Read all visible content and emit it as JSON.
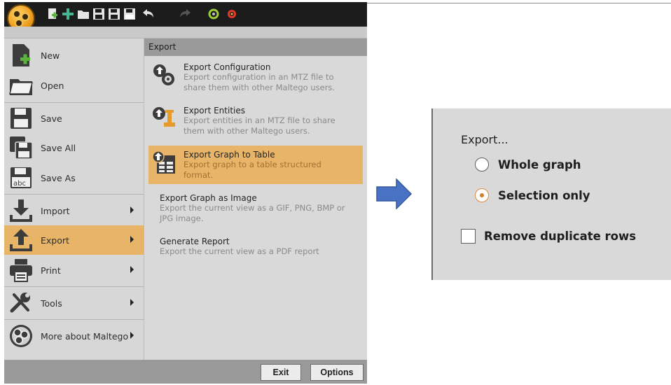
{
  "colors": {
    "accent": "#e8b468",
    "arrow": "#4a72c4",
    "radio_selected": "#d07f2a"
  },
  "toolbar_icons": [
    "new-graph-icon",
    "add-entity-icon",
    "open-folder-icon",
    "save-icon",
    "save-all-icon",
    "save-as-icon",
    "undo-icon",
    "redo-icon",
    "transform-icon",
    "settings-icon"
  ],
  "menu": {
    "items": [
      {
        "label": "New",
        "icon": "new-file-icon",
        "has_submenu": false,
        "active": false
      },
      {
        "label": "Open",
        "icon": "open-folder-icon",
        "has_submenu": false,
        "active": false
      },
      {
        "label": "Save",
        "icon": "save-icon",
        "has_submenu": false,
        "active": false
      },
      {
        "label": "Save All",
        "icon": "save-all-icon",
        "has_submenu": false,
        "active": false
      },
      {
        "label": "Save As",
        "icon": "save-as-icon",
        "has_submenu": false,
        "active": false
      },
      {
        "label": "Import",
        "icon": "import-icon",
        "has_submenu": true,
        "active": false
      },
      {
        "label": "Export",
        "icon": "export-icon",
        "has_submenu": true,
        "active": true
      },
      {
        "label": "Print",
        "icon": "print-icon",
        "has_submenu": true,
        "active": false
      },
      {
        "label": "Tools",
        "icon": "tools-icon",
        "has_submenu": true,
        "active": false
      },
      {
        "label": "More about Maltego",
        "icon": "maltego-icon",
        "has_submenu": true,
        "active": false
      }
    ]
  },
  "submenu": {
    "title": "Export",
    "items": [
      {
        "title": "Export Configuration",
        "desc": [
          "Export configuration in an MTZ file to",
          "share them with other Maltego users."
        ],
        "icon": "export-config-icon",
        "active": false
      },
      {
        "title": "Export Entities",
        "desc": [
          "Export entities in an MTZ file to share",
          "them with other Maltego users."
        ],
        "icon": "export-entities-icon",
        "active": false
      },
      {
        "title": "Export Graph to Table",
        "desc": [
          "Export graph to a table structured",
          "format."
        ],
        "icon": "export-table-icon",
        "active": true
      },
      {
        "title": "Export Graph as Image",
        "desc": [
          "Export the current view as a GIF, PNG, BMP or",
          "JPG image."
        ],
        "icon": null,
        "active": false
      },
      {
        "title": "Generate Report",
        "desc": [
          "Export the current view as a PDF report"
        ],
        "icon": null,
        "active": false
      }
    ]
  },
  "buttons": {
    "exit": "Exit",
    "options": "Options"
  },
  "dialog": {
    "title": "Export...",
    "options": [
      {
        "label": "Whole graph",
        "selected": false
      },
      {
        "label": "Selection only",
        "selected": true
      }
    ],
    "checkbox": {
      "label": "Remove duplicate rows",
      "checked": false
    }
  }
}
